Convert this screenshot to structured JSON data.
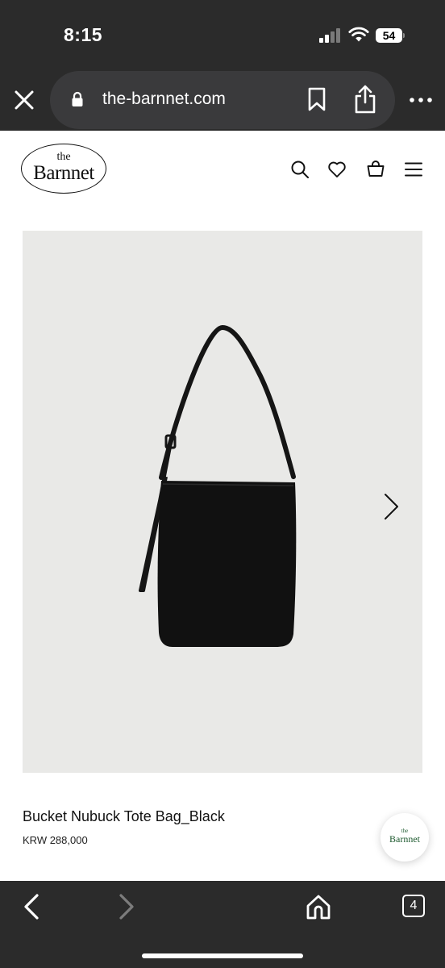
{
  "status_bar": {
    "time": "8:15",
    "battery_level": "54",
    "signal_bars_active": 2,
    "signal_bars_total": 4
  },
  "browser": {
    "url": "the-barnnet.com",
    "icons": [
      "close-icon",
      "lock-icon",
      "bookmark-icon",
      "share-icon",
      "more-icon"
    ],
    "open_tabs": "4"
  },
  "site": {
    "logo_small": "the",
    "logo_word": "Barnnet",
    "header_icons": [
      "search-icon",
      "heart-icon",
      "bag-icon",
      "menu-icon"
    ]
  },
  "product": {
    "name": "Bucket Nubuck Tote Bag_Black",
    "price": "KRW 288,000",
    "image_background": "#e9e9e7",
    "bag_color": "#111111"
  },
  "chat_badge": {
    "small": "the",
    "word": "Barnnet",
    "color": "#1e5a2f"
  },
  "bottom_toolbar": {
    "icons": [
      "back-icon",
      "forward-icon",
      "home-icon",
      "tabs-icon"
    ]
  }
}
